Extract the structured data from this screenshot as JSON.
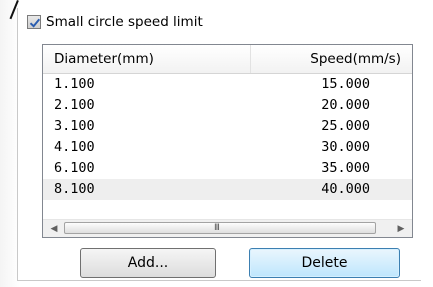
{
  "checkbox": {
    "label": "Small circle speed limit",
    "checked": true
  },
  "table": {
    "columns": [
      "Diameter(mm)",
      "Speed(mm/s)"
    ],
    "rows": [
      [
        "1.100",
        "15.000"
      ],
      [
        "2.100",
        "20.000"
      ],
      [
        "3.100",
        "25.000"
      ],
      [
        "4.100",
        "30.000"
      ],
      [
        "6.100",
        "35.000"
      ],
      [
        "8.100",
        "40.000"
      ]
    ],
    "selected_row": 5
  },
  "scrollbar": {
    "left_icon": "left-arrow-icon",
    "right_icon": "right-arrow-icon",
    "grip": "III"
  },
  "buttons": {
    "add": "Add...",
    "delete": "Delete"
  }
}
